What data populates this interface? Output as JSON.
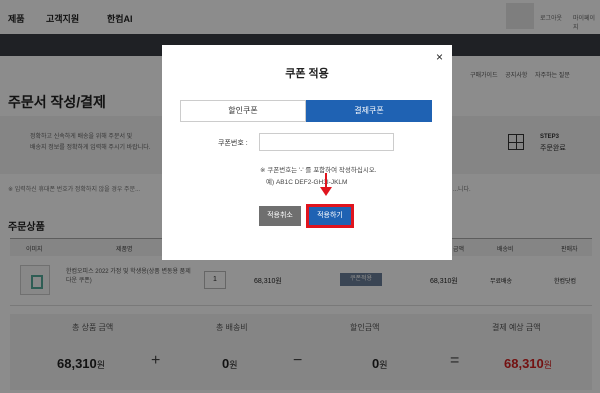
{
  "nav": {
    "items": [
      "제품",
      "고객지원",
      "한컴AI"
    ],
    "util": [
      "로그아웃",
      "마이페이지"
    ]
  },
  "links": [
    "구매가이드",
    "공지사항",
    "자주하는 질문"
  ],
  "page_title": "주문서 작성/결제",
  "steps": {
    "desc": "정확하고 신속하게 배송을 위해 주문서 및\n배송지 정보를 정확하게 입력해 주시기 바랍니다.",
    "step_num": "STEP3",
    "step_name": "주문완료"
  },
  "notice": "※ 입력하신 휴대폰 번호가 정확하지 않을 경우 주문...",
  "notice_right": "...니다.",
  "order_products": {
    "title": "주문상품",
    "headers": [
      "이미지",
      "제품명",
      "금액",
      "배송비",
      "판매자"
    ],
    "row": {
      "name": "한컴오피스 2022 가정 및 학생용(상품 변동용 품제다운 쿠폰)",
      "qty": "1",
      "price": "68,310원",
      "coupon_btn": "쿠폰적용",
      "total": "68,310원",
      "shipping": "무료배송",
      "seller": "한컴닷컴"
    }
  },
  "summary": {
    "labels": [
      "총 상품 금액",
      "총 배송비",
      "할인금액",
      "결제 예상 금액"
    ],
    "values": [
      "68,310",
      "0",
      "0",
      "68,310"
    ],
    "unit": "원",
    "ops": [
      "+",
      "−",
      "="
    ]
  },
  "modal": {
    "title": "쿠폰 적용",
    "close": "×",
    "tabs": [
      "할인쿠폰",
      "결제쿠폰"
    ],
    "code_label": "쿠폰번호 :",
    "code_value": "",
    "hint1": "※ 쿠폰번호는 '-' 를 포함하여 작성하십시오.",
    "hint2": "예) AB1C DEF2-GH3I-JKLM",
    "cancel": "적용취소",
    "apply": "적용하기"
  },
  "colors": {
    "primary": "#1f62b3",
    "highlight": "#e0141e",
    "dark_bar": "#3a3d44"
  }
}
